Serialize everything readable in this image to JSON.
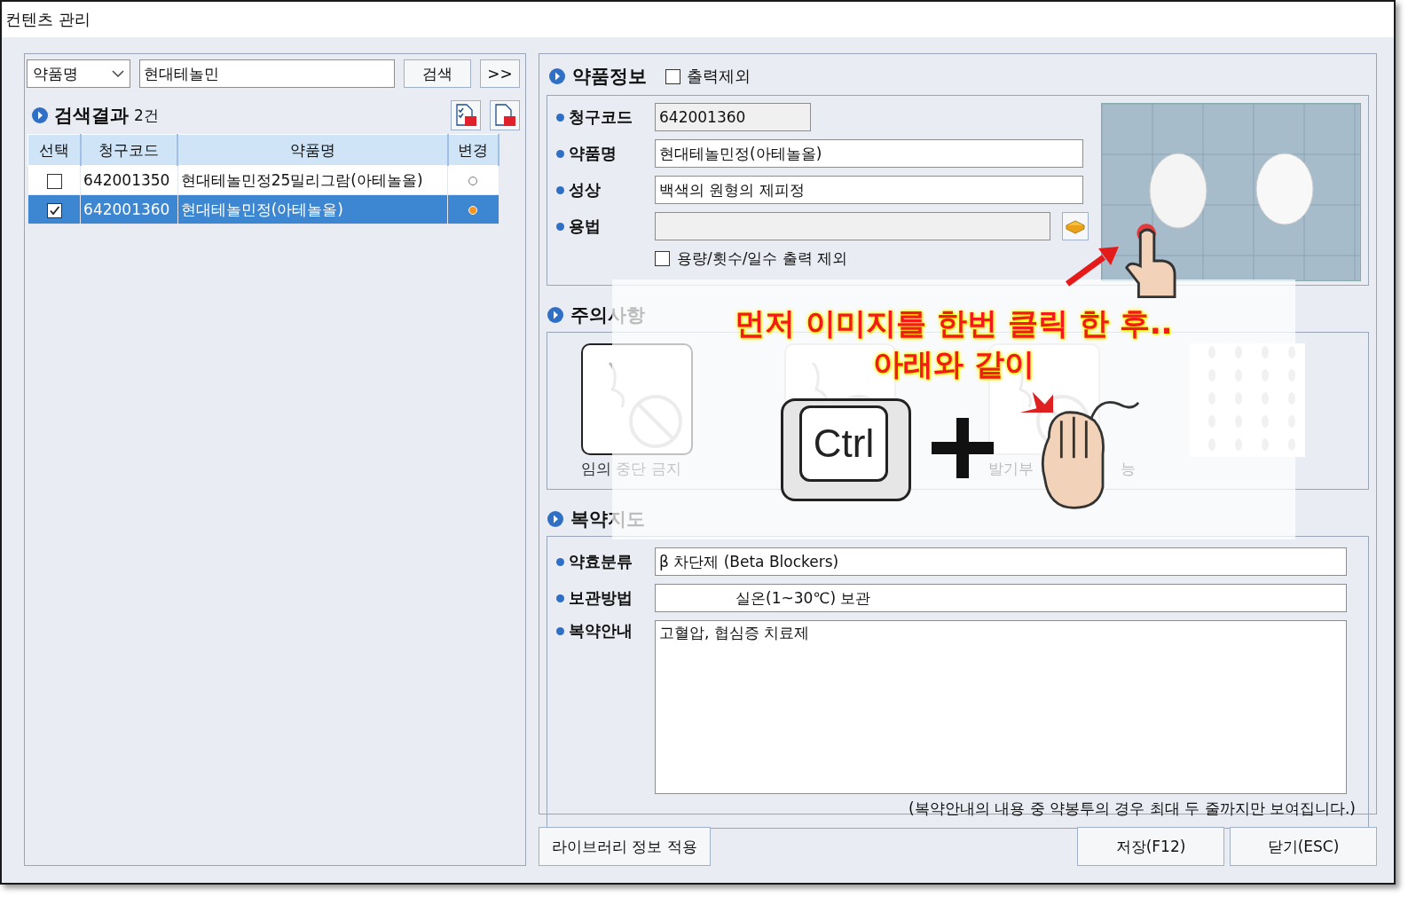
{
  "window": {
    "title": "컨텐츠 관리"
  },
  "search": {
    "field_type": "약품명",
    "query": "현대테놀민",
    "buttons": [
      "검색",
      ">>"
    ]
  },
  "results": {
    "title": "검색결과",
    "count": "2건",
    "columns": [
      "선택",
      "청구코드",
      "약품명",
      "변경"
    ],
    "rows": [
      {
        "checked": false,
        "code": "642001350",
        "name": "현대테놀민정25밀리그람(아테놀올)",
        "changed": false,
        "selected": false
      },
      {
        "checked": true,
        "code": "642001360",
        "name": "현대테놀민정(아테놀올)",
        "changed": true,
        "selected": true
      }
    ]
  },
  "drug_info": {
    "title": "약품정보",
    "exclude_print": {
      "label": "출력제외",
      "checked": false
    },
    "fields": [
      {
        "label": "청구코드",
        "value": "642001360",
        "kind": "readonly"
      },
      {
        "label": "약품명",
        "value": "현대테놀민정(아테놀올)",
        "kind": "text"
      },
      {
        "label": "성상",
        "value": "백색의 원형의 제피정",
        "kind": "text"
      },
      {
        "label": "용법",
        "kind": "lookup"
      }
    ],
    "dose_exclude": {
      "label": "용량/횟수/일수 출력 제외",
      "checked": false
    }
  },
  "cautions": {
    "title": "주의사항",
    "items": [
      {
        "kind": "pictogram",
        "label_parts": [
          "임의 중단 금지"
        ]
      },
      {
        "kind": "pictogram"
      },
      {
        "kind": "pictogram",
        "label_parts": [
          "발기부",
          "능"
        ]
      },
      {
        "kind": "pattern"
      }
    ]
  },
  "guidance": {
    "title": "복약지도",
    "fields": [
      {
        "label": "약효분류",
        "value": "β 차단제 (Beta Blockers)",
        "kind": "line"
      },
      {
        "label": "보관방법",
        "value": "실온(1~30℃) 보관",
        "kind": "line"
      },
      {
        "label": "복약안내",
        "value": "고혈압, 협심증 치료제",
        "kind": "area"
      }
    ],
    "note": "(복약안내의 내용 중 약봉투의 경우 최대 두 줄까지만 보여집니다.)"
  },
  "buttons": {
    "library": "라이브러리 정보 적용",
    "save": "저장(F12)",
    "close": "닫기(ESC)"
  },
  "tutorial": {
    "lines": [
      "먼저 이미지를 한번 클릭 한 후..",
      "아래와 같이"
    ],
    "key": "Ctrl"
  }
}
